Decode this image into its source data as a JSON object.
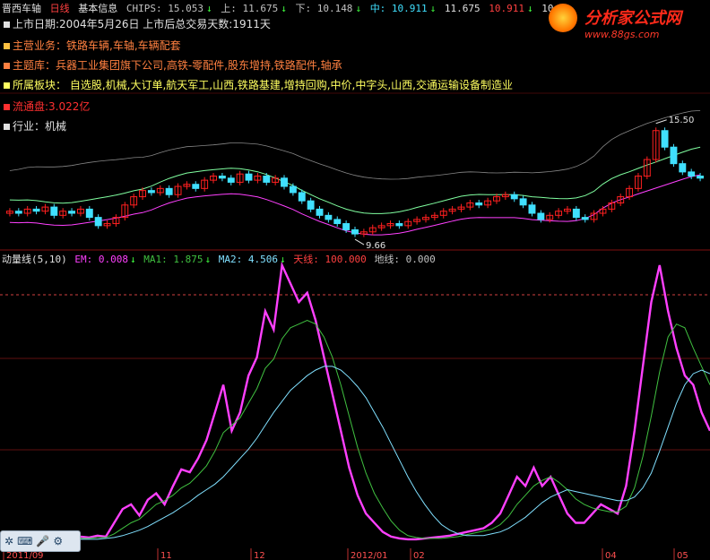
{
  "header": {
    "stock_name": "晋西车轴",
    "period": "日线",
    "basic_info": "基本信息",
    "chips": "CHIPS: 15.053",
    "up": "上: 11.675",
    "down": "下: 10.148",
    "mid": "中: 10.911",
    "v4": "11.675",
    "v5": "10.911",
    "v6": "10.1…"
  },
  "info": {
    "listing": "上市日期:2004年5月26日  上市后总交易天数:1911天",
    "business": "主营业务：铁路车辆,车轴,车辆配套",
    "themes": "主题库：兵器工业集团旗下公司,高铁-零配件,股东增持,铁路配件,轴承",
    "sectors": "所属板块：  自选股,机械,大订单,航天军工,山西,铁路基建,增持回购,中价,中字头,山西,交通运输设备制造业",
    "float": "流通盘:3.022亿",
    "industry": "行业：机械"
  },
  "logo": {
    "title": "分析家公式网",
    "url": "www.88gs.com"
  },
  "indicator": {
    "name": "动量线(5,10)",
    "em": "EM: 0.008",
    "ma1": "MA1: 1.875",
    "ma2": "MA2: 4.506",
    "sky": "天线: 100.000",
    "ground": "地线: 0.000"
  },
  "input_bar": {
    "icons": [
      "settings-icon",
      "keyboard-icon",
      "microphone-icon",
      "gear-icon"
    ]
  },
  "colors": {
    "em": "#ff40ff",
    "ma1": "#40c040",
    "ma2": "#80e0ff",
    "up": "#ff2020",
    "down": "#40e0ff",
    "upper_band": "#80ffa0",
    "lower_band": "#ff40ff",
    "chips": "#c0c0c0"
  },
  "chart_data": [
    {
      "type": "candlestick",
      "title": "晋西车轴 日线",
      "annotations": [
        {
          "label": "15.50",
          "kind": "high"
        },
        {
          "label": "9.66",
          "kind": "low"
        }
      ],
      "x_ticks": [
        "2011/09",
        "11",
        "12",
        "2012/01",
        "02",
        "04",
        "05"
      ],
      "closes": [
        10.9,
        10.8,
        11.0,
        10.9,
        11.1,
        10.7,
        10.9,
        10.8,
        11.0,
        10.6,
        10.2,
        10.3,
        10.6,
        11.2,
        11.6,
        11.9,
        11.8,
        12.0,
        11.7,
        12.1,
        12.2,
        12.0,
        12.4,
        12.6,
        12.5,
        12.3,
        12.7,
        12.4,
        12.6,
        12.3,
        12.5,
        12.1,
        11.8,
        11.4,
        11.0,
        10.7,
        10.5,
        10.3,
        10.0,
        9.8,
        9.9,
        10.1,
        10.2,
        10.3,
        10.2,
        10.4,
        10.5,
        10.6,
        10.7,
        10.9,
        11.0,
        11.1,
        11.3,
        11.2,
        11.4,
        11.6,
        11.7,
        11.5,
        11.2,
        10.8,
        10.5,
        10.7,
        10.9,
        11.0,
        10.6,
        10.5,
        10.8,
        11.0,
        11.3,
        11.6,
        12.0,
        12.6,
        13.4,
        14.8,
        14.0,
        13.2,
        12.8,
        12.6,
        12.5
      ]
    },
    {
      "type": "line",
      "title": "动量线(5,10)",
      "series": [
        {
          "name": "EM",
          "values": [
            5,
            4,
            6,
            5,
            20,
            35,
            40,
            28,
            45,
            52,
            40,
            60,
            78,
            75,
            90,
            110,
            140,
            170,
            120,
            140,
            180,
            200,
            250,
            230,
            300,
            280,
            260,
            270,
            240,
            200,
            160,
            120,
            80,
            50,
            30,
            20,
            10,
            5,
            3,
            2,
            2,
            3,
            4,
            5,
            6,
            8,
            10,
            12,
            14,
            20,
            30,
            50,
            70,
            60,
            80,
            60,
            70,
            50,
            30,
            20,
            20,
            30,
            40,
            35,
            30,
            60,
            120,
            190,
            260,
            300,
            250,
            210,
            180,
            170,
            140,
            120
          ]
        },
        {
          "name": "MA1",
          "values": [
            3,
            3,
            4,
            4,
            8,
            14,
            20,
            24,
            32,
            40,
            44,
            50,
            58,
            63,
            72,
            82,
            98,
            118,
            126,
            134,
            150,
            166,
            188,
            198,
            220,
            232,
            236,
            240,
            236,
            222,
            200,
            170,
            136,
            102,
            74,
            52,
            36,
            22,
            12,
            6,
            4,
            3,
            3,
            3,
            4,
            5,
            7,
            9,
            11,
            13,
            18,
            27,
            40,
            50,
            60,
            66,
            70,
            64,
            56,
            46,
            40,
            36,
            34,
            32,
            32,
            38,
            58,
            92,
            136,
            184,
            222,
            236,
            232,
            210,
            190,
            170
          ]
        },
        {
          "name": "MA2",
          "values": [
            2,
            2,
            2,
            3,
            4,
            6,
            9,
            12,
            16,
            21,
            26,
            31,
            37,
            43,
            50,
            56,
            62,
            70,
            80,
            90,
            100,
            112,
            126,
            140,
            152,
            164,
            172,
            180,
            186,
            190,
            190,
            186,
            178,
            168,
            156,
            140,
            124,
            106,
            88,
            70,
            54,
            40,
            28,
            18,
            12,
            8,
            6,
            6,
            6,
            8,
            10,
            14,
            20,
            26,
            34,
            42,
            48,
            52,
            56,
            54,
            52,
            50,
            48,
            46,
            44,
            44,
            48,
            58,
            74,
            98,
            124,
            150,
            170,
            182,
            186,
            182
          ]
        }
      ],
      "ylim": [
        0,
        300
      ]
    }
  ]
}
